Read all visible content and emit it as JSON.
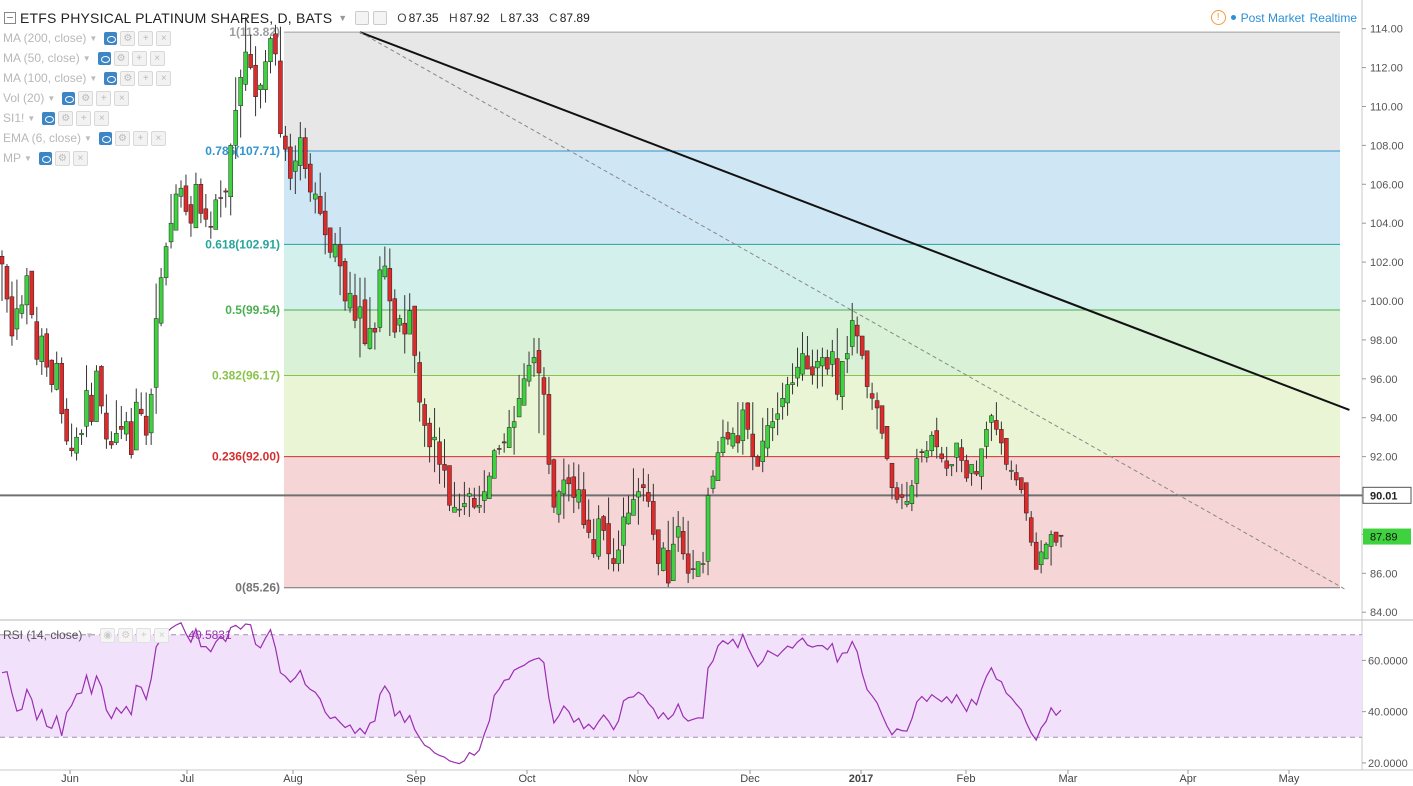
{
  "header": {
    "title": "ETFS PHYSICAL PLATINUM SHARES, D, BATS",
    "ohlc": [
      {
        "key": "O",
        "value": "87.35"
      },
      {
        "key": "H",
        "value": "87.92"
      },
      {
        "key": "L",
        "value": "87.33"
      },
      {
        "key": "C",
        "value": "87.89"
      }
    ],
    "post_market": "Post Market",
    "realtime": "Realtime"
  },
  "indicators": [
    {
      "label": "MA (200, close)"
    },
    {
      "label": "MA (50, close)"
    },
    {
      "label": "MA (100, close)"
    },
    {
      "label": "Vol (20)"
    },
    {
      "label": "SI1!"
    },
    {
      "label": "EMA (6, close)"
    },
    {
      "label": "MP"
    }
  ],
  "rsi_panel": {
    "label": "RSI (14, close)",
    "value": "40.5831"
  },
  "colors": {
    "up": "#3fd23f",
    "down": "#dd2a2a",
    "rsi_line": "#9a2fb0",
    "rsi_band": "#f1e1fb",
    "trendline": "#111111",
    "hline": "#707070"
  },
  "chart_data": {
    "type": "candlestick",
    "y_axis": {
      "range": [
        83.6,
        114.6
      ],
      "ticks": [
        "114.00",
        "112.00",
        "110.00",
        "108.00",
        "106.00",
        "104.00",
        "102.00",
        "100.00",
        "98.00",
        "96.00",
        "94.00",
        "92.00",
        "90.00",
        "88.00",
        "86.00",
        "84.00"
      ]
    },
    "x_axis": {
      "labels": [
        "Jun",
        "Jul",
        "Aug",
        "Sep",
        "Oct",
        "Nov",
        "Dec",
        "2017",
        "Feb",
        "Mar",
        "Apr",
        "May"
      ]
    },
    "fib_levels": [
      {
        "ratio": 1,
        "price": 113.82,
        "label": "1(113.82)",
        "color": "#9e9e9e",
        "fill": "#e7e7e7"
      },
      {
        "ratio": 0.786,
        "price": 107.71,
        "label": "0.786(107.71)",
        "color": "#2f95d0",
        "fill": "#cfe6f4"
      },
      {
        "ratio": 0.618,
        "price": 102.91,
        "label": "0.618(102.91)",
        "color": "#26a69a",
        "fill": "#d3f0ec"
      },
      {
        "ratio": 0.5,
        "price": 99.54,
        "label": "0.5(99.54)",
        "color": "#4caf50",
        "fill": "#d9f1d6"
      },
      {
        "ratio": 0.382,
        "price": 96.17,
        "label": "0.382(96.17)",
        "color": "#8bc34a",
        "fill": "#e9f5d4"
      },
      {
        "ratio": 0.236,
        "price": 92.0,
        "label": "0.236(92.00)",
        "color": "#d32f2f",
        "fill": "#f5d5d5"
      },
      {
        "ratio": 0,
        "price": 85.26,
        "label": "0(85.26)",
        "color": "#757575"
      }
    ],
    "horizontal_line": {
      "price": 90.01,
      "label": "90.01"
    },
    "last_price": {
      "price": 87.89,
      "label": "87.89"
    },
    "trendlines": [
      {
        "style": "solid",
        "from": [
          "2016-08-10",
          113.82
        ],
        "to": [
          "2017-05-16",
          94.4
        ]
      },
      {
        "style": "dashed",
        "from": [
          "2016-08-10",
          113.82
        ],
        "to": [
          "2017-05-15",
          85.2
        ]
      }
    ],
    "ohlc_series": {
      "start_date": "2016-05-02",
      "closes": [
        101.9,
        100.1,
        98.2,
        99.6,
        99.8,
        101.3,
        99.3,
        97.0,
        98.2,
        96.6,
        95.7,
        96.8,
        94.2,
        92.8,
        92.3,
        93.0,
        93.2,
        95.4,
        93.8,
        96.4,
        94.6,
        92.9,
        92.6,
        93.2,
        93.4,
        93.8,
        92.1,
        94.8,
        94.2,
        93.1,
        95.2,
        99.1,
        101.2,
        102.8,
        104.0,
        105.5,
        105.8,
        104.6,
        104.0,
        106.0,
        104.5,
        104.2,
        103.8,
        105.2,
        105.3,
        105.6,
        108.0,
        109.8,
        111.5,
        112.8,
        112.0,
        110.5,
        111.1,
        112.3,
        113.5,
        112.7,
        108.6,
        107.8,
        106.3,
        107.2,
        108.4,
        106.8,
        105.6,
        105.5,
        104.5,
        103.4,
        102.5,
        102.9,
        101.8,
        100.0,
        100.4,
        99.0,
        99.7,
        97.8,
        98.6,
        98.4,
        101.6,
        101.8,
        100.0,
        98.4,
        99.1,
        98.3,
        99.5,
        97.2,
        94.8,
        93.6,
        92.5,
        93.0,
        91.6,
        91.3,
        89.5,
        89.4,
        89.3,
        89.6,
        90.1,
        89.4,
        89.5,
        90.2,
        91.0,
        92.3,
        92.4,
        92.7,
        93.5,
        93.8,
        95.0,
        96.0,
        96.7,
        97.1,
        96.3,
        95.2,
        91.6,
        89.4,
        90.2,
        90.8,
        90.6,
        89.9,
        90.3,
        88.5,
        88.1,
        87.0,
        88.8,
        88.2,
        87.0,
        86.5,
        87.2,
        88.9,
        89.1,
        89.8,
        90.2,
        90.4,
        89.7,
        88.0,
        86.5,
        87.3,
        85.5,
        87.5,
        88.4,
        87.0,
        86.0,
        86.2,
        86.6,
        86.5,
        90.0,
        91.0,
        92.2,
        93.0,
        92.9,
        93.2,
        92.7,
        94.4,
        93.4,
        92.0,
        91.5,
        92.8,
        93.6,
        93.8,
        94.2,
        95.0,
        95.7,
        95.8,
        96.6,
        97.3,
        96.5,
        96.2,
        96.9,
        97.1,
        96.5,
        97.4,
        95.2,
        96.9,
        97.3,
        99.0,
        98.2,
        97.2,
        95.6,
        95.0,
        94.5,
        93.2,
        91.9,
        90.4,
        89.8,
        89.9,
        89.7,
        90.5,
        91.9,
        92.2,
        92.3,
        93.1,
        92.5,
        91.9,
        91.4,
        91.6,
        92.7,
        91.8,
        90.9,
        91.6,
        91.1,
        92.4,
        93.4,
        94.1,
        93.4,
        92.7,
        91.6,
        91.3,
        90.8,
        90.3,
        89.1,
        87.6,
        86.2,
        87.1,
        87.5,
        88.0,
        87.6,
        87.9
      ],
      "highs": [
        102.6,
        101.9,
        101.0,
        101.1,
        100.3,
        101.7,
        101.3,
        99.7,
        98.6,
        98.6,
        97.0,
        97.4,
        97.1,
        95.0,
        93.7,
        93.5,
        93.4,
        96.7,
        95.8,
        96.7,
        96.7,
        95.2,
        93.3,
        94.9,
        94.6,
        94.3,
        94.5,
        95.5,
        95.3,
        95.3,
        95.5,
        100.9,
        101.7,
        103.0,
        105.5,
        106.0,
        106.2,
        106.5,
        105.4,
        106.6,
        106.3,
        105.5,
        104.6,
        105.5,
        106.2,
        105.8,
        108.1,
        111.5,
        111.9,
        114.6,
        113.7,
        113.1,
        111.2,
        112.9,
        113.6,
        114.2,
        114.1,
        109.0,
        108.6,
        108.0,
        109.2,
        108.9,
        107.6,
        106.1,
        106.6,
        105.6,
        103.7,
        103.5,
        103.8,
        102.2,
        101.5,
        101.4,
        101.2,
        101.2,
        100.2,
        98.9,
        102.3,
        102.8,
        102.7,
        100.6,
        99.3,
        100.3,
        100.4,
        99.5,
        97.4,
        95.0,
        94.0,
        94.5,
        93.5,
        92.9,
        91.1,
        90.7,
        90.1,
        90.7,
        90.4,
        90.4,
        90.5,
        91.3,
        91.2,
        92.4,
        92.6,
        93.2,
        94.4,
        94.6,
        96.2,
        96.8,
        97.4,
        98.1,
        98.1,
        96.6,
        96.1,
        91.9,
        90.3,
        91.9,
        91.6,
        91.7,
        91.6,
        91.2,
        89.8,
        88.8,
        89.5,
        89.0,
        89.9,
        87.8,
        88.2,
        89.9,
        90.0,
        91.4,
        90.9,
        91.4,
        91.1,
        90.6,
        88.1,
        87.6,
        88.7,
        88.9,
        89.2,
        88.9,
        88.7,
        87.2,
        86.6,
        87.1,
        90.4,
        91.3,
        92.8,
        93.9,
        93.8,
        93.5,
        94.8,
        94.8,
        94.8,
        94.8,
        92.1,
        94.0,
        94.5,
        94.5,
        95.3,
        95.8,
        96.1,
        96.8,
        97.6,
        98.4,
        98.2,
        97.5,
        97.5,
        97.6,
        97.5,
        98.0,
        98.6,
        96.8,
        98.2,
        99.9,
        99.2,
        98.2,
        97.3,
        95.8,
        95.3,
        94.6,
        93.2,
        91.6,
        90.7,
        90.6,
        90.7,
        90.8,
        92.4,
        92.4,
        92.8,
        93.3,
        94.0,
        92.5,
        92.5,
        91.6,
        92.7,
        92.9,
        92.1,
        91.6,
        91.8,
        92.4,
        93.8,
        94.2,
        94.8,
        93.8,
        92.8,
        91.8,
        91.6,
        90.8,
        90.4,
        89.2,
        88.1,
        87.7,
        87.6,
        88.2,
        88.0,
        87.92
      ],
      "lows": [
        100.0,
        99.4,
        97.7,
        98.0,
        99.1,
        98.8,
        99.1,
        96.7,
        96.2,
        96.1,
        95.3,
        95.4,
        93.7,
        92.6,
        92.0,
        91.8,
        92.6,
        93.0,
        93.6,
        93.9,
        94.2,
        92.4,
        92.4,
        92.6,
        92.9,
        92.8,
        91.9,
        93.1,
        94.1,
        92.6,
        92.6,
        94.2,
        98.7,
        100.8,
        102.7,
        103.9,
        104.8,
        104.4,
        103.3,
        103.8,
        104.0,
        103.8,
        103.2,
        103.8,
        104.3,
        104.8,
        104.4,
        107.3,
        108.4,
        110.8,
        111.9,
        109.5,
        109.9,
        110.2,
        111.7,
        112.1,
        108.4,
        107.2,
        105.7,
        105.5,
        106.2,
        106.3,
        105.1,
        104.5,
        104.4,
        102.4,
        102.2,
        102.0,
        100.3,
        99.5,
        99.4,
        98.6,
        97.1,
        97.7,
        97.5,
        97.5,
        98.4,
        101.1,
        98.2,
        98.1,
        98.4,
        97.3,
        98.8,
        96.3,
        93.8,
        92.5,
        91.7,
        91.2,
        90.6,
        90.4,
        89.2,
        89.2,
        88.9,
        89.0,
        88.9,
        89.3,
        89.1,
        89.1,
        90.0,
        91.2,
        92.1,
        92.2,
        92.6,
        92.1,
        94.4,
        95.0,
        95.6,
        96.1,
        93.2,
        93.1,
        91.1,
        89.1,
        88.6,
        88.8,
        89.7,
        89.1,
        89.3,
        88.3,
        87.8,
        86.8,
        86.7,
        87.7,
        86.2,
        86.1,
        86.1,
        86.5,
        88.5,
        89.0,
        88.5,
        89.7,
        89.4,
        87.7,
        85.9,
        86.1,
        85.3,
        85.7,
        87.1,
        86.7,
        85.5,
        85.7,
        86.2,
        86.0,
        85.9,
        90.1,
        91.8,
        92.0,
        92.6,
        92.4,
        92.2,
        92.1,
        92.9,
        91.3,
        91.6,
        91.2,
        92.0,
        92.8,
        93.1,
        93.9,
        94.1,
        95.2,
        95.6,
        95.9,
        96.6,
        95.7,
        95.5,
        95.6,
        96.2,
        96.1,
        94.9,
        94.4,
        96.3,
        97.2,
        97.3,
        97.0,
        95.0,
        94.4,
        93.4,
        92.9,
        91.8,
        89.8,
        89.6,
        89.3,
        89.4,
        89.2,
        89.9,
        91.7,
        91.7,
        92.0,
        91.9,
        91.7,
        91.0,
        91.0,
        91.2,
        91.2,
        90.7,
        90.5,
        91.0,
        90.3,
        91.9,
        92.8,
        93.1,
        92.1,
        91.3,
        90.8,
        90.5,
        90.1,
        88.7,
        87.4,
        86.2,
        86.0,
        86.8,
        86.4,
        87.4,
        87.33
      ]
    },
    "rsi": {
      "range": [
        18,
        75
      ],
      "ticks": [
        "60.0000",
        "40.0000",
        "20.0000"
      ],
      "bands": [
        70,
        30
      ],
      "values": [
        55.2,
        55.6,
        47.3,
        40.2,
        40.9,
        48.7,
        44.8,
        36.8,
        40.8,
        34.3,
        33.5,
        38.3,
        30.6,
        39.6,
        42.4,
        46.9,
        47.3,
        54.2,
        47.0,
        53.9,
        49.8,
        40.6,
        37.3,
        41.6,
        39.4,
        42.0,
        38.8,
        50.3,
        49.5,
        44.8,
        52.8,
        65.2,
        68.4,
        70.7,
        72.5,
        73.8,
        74.7,
        70.4,
        67.1,
        72.3,
        65.4,
        65.4,
        63.4,
        67.2,
        69.5,
        67.4,
        72.8,
        73.7,
        72.2,
        74.2,
        73.9,
        66.3,
        64.9,
        68.7,
        72.0,
        64.8,
        55.2,
        53.8,
        51.5,
        53.3,
        56.1,
        50.6,
        48.7,
        47.6,
        44.9,
        39.8,
        37.3,
        37.9,
        35.8,
        33.8,
        34.8,
        31.5,
        33.5,
        31.3,
        35.5,
        36.4,
        46.7,
        50.0,
        47.0,
        38.3,
        40.2,
        35.8,
        38.5,
        33.0,
        29.8,
        26.9,
        25.8,
        23.9,
        22.9,
        22.2,
        20.8,
        20.2,
        19.7,
        20.8,
        24.0,
        23.0,
        25.0,
        31.2,
        36.3,
        46.3,
        48.8,
        52.2,
        52.7,
        56.2,
        57.2,
        58.1,
        59.5,
        60.4,
        60.9,
        59.1,
        45.3,
        35.6,
        38.4,
        42.2,
        40.0,
        35.9,
        37.4,
        33.4,
        35.1,
        33.1,
        36.1,
        38.7,
        36.3,
        33.0,
        36.4,
        44.2,
        45.5,
        45.8,
        47.6,
        46.3,
        43.2,
        41.2,
        37.3,
        39.6,
        37.0,
        38.8,
        43.0,
        38.1,
        36.3,
        37.0,
        37.6,
        37.5,
        57.0,
        59.8,
        65.7,
        67.7,
        66.4,
        68.3,
        65.0,
        70.2,
        65.1,
        61.2,
        57.6,
        59.7,
        63.8,
        62.7,
        61.6,
        63.7,
        65.6,
        64.8,
        67.2,
        68.7,
        66.0,
        65.2,
        65.8,
        65.8,
        64.2,
        66.6,
        59.4,
        62.8,
        63.0,
        67.4,
        63.4,
        54.9,
        48.6,
        46.2,
        43.4,
        38.8,
        34.4,
        31.0,
        33.3,
        32.6,
        32.4,
        37.2,
        43.8,
        45.9,
        44.0,
        46.6,
        45.2,
        43.9,
        45.8,
        43.4,
        46.6,
        43.3,
        40.1,
        44.8,
        42.7,
        48.8,
        53.8,
        57.1,
        52.7,
        51.7,
        47.2,
        45.4,
        42.9,
        40.7,
        35.8,
        31.7,
        28.9,
        33.6,
        36.2,
        41.5,
        38.6,
        40.58
      ]
    }
  }
}
